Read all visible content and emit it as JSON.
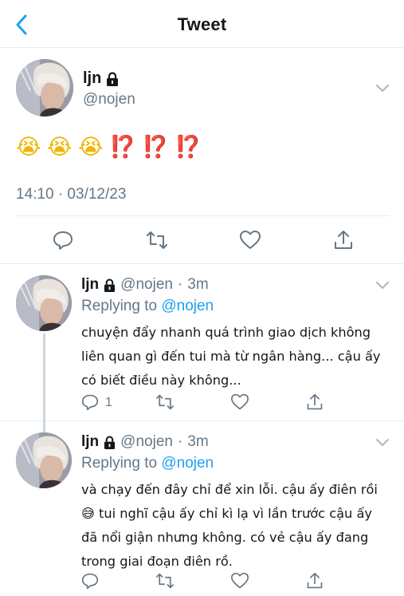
{
  "header": {
    "title": "Tweet",
    "back_icon": "chevron-left-icon",
    "accent": "#1da1f2"
  },
  "main_tweet": {
    "display_name": "ljn",
    "handle": "@nojen",
    "text_emojis": "😭 😭 😭",
    "text_marks": "⁉️ ⁉️ ⁉️",
    "timestamp": "14:10 · 03/12/23",
    "actions": [
      "reply-icon",
      "retweet-icon",
      "like-icon",
      "share-icon"
    ]
  },
  "replies": [
    {
      "display_name": "ljn",
      "handle": "@nojen",
      "time": "3m",
      "replying_label": "Replying to",
      "replying_to": "@nojen",
      "text": "chuyện đẩy nhanh quá trình giao dịch không liên quan gì đến tui mà từ ngân hàng... cậu ấy có biết điều này không...",
      "reply_count": "1"
    },
    {
      "display_name": "ljn",
      "handle": "@nojen",
      "time": "3m",
      "replying_label": "Replying to",
      "replying_to": "@nojen",
      "text": "và chạy đến đây chỉ để xin lỗi. cậu ấy điên rồi😅 tui nghĩ cậu ấy chỉ kì lạ vì lần trước cậu ấy đã nổi giận nhưng không. có vẻ cậu ấy đang trong giai đoạn điên rồ.",
      "reply_count": ""
    }
  ],
  "colors": {
    "text": "#14171a",
    "secondary": "#657786",
    "mention": "#1da1f2",
    "divider": "#e6ecf0",
    "thread_line": "#ccd6dd"
  }
}
